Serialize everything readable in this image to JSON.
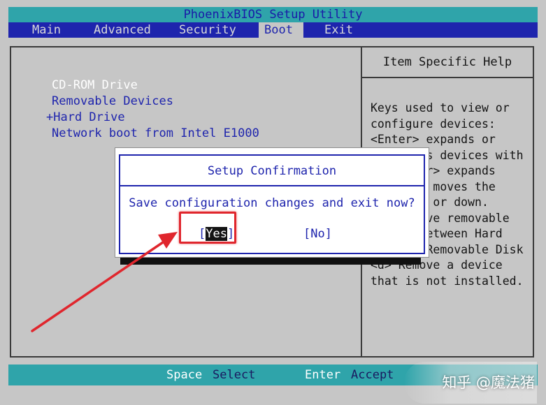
{
  "title": "PhoenixBIOS Setup Utility",
  "menu": [
    {
      "label": "Main"
    },
    {
      "label": "Advanced"
    },
    {
      "label": "Security"
    },
    {
      "label": "Boot"
    },
    {
      "label": "Exit"
    }
  ],
  "active_menu": "Boot",
  "boot_list": [
    "CD-ROM Drive",
    "Removable Devices",
    "+Hard Drive",
    "Network boot from Intel E1000"
  ],
  "selected_boot_item": "CD-ROM Drive",
  "help": {
    "title": "Item Specific Help",
    "lines": [
      "Keys used to view or",
      "configure devices:",
      "<Enter> expands or",
      "        s devices with",
      "",
      "      ter> expands",
      "",
      "     <-> moves the",
      "       p or down.",
      "       ove removable",
      "device between Hard",
      "Disk or Removable Disk",
      "<d> Remove a device",
      "that is not installed."
    ]
  },
  "dialog": {
    "title": "Setup Confirmation",
    "question": "Save configuration changes and exit now?",
    "yes_open": "[",
    "yes_label": "Yes",
    "yes_close": "]",
    "no_label": "[No]"
  },
  "status": [
    {
      "key": "Space",
      "desc": "Select"
    },
    {
      "key": "Enter",
      "desc": "Accept"
    }
  ],
  "watermark": "知乎 @魔法猪",
  "colors": {
    "bios_blue": "#1e24ad",
    "bios_cyan": "#2fa4aa",
    "bios_gray": "#c6c6c6",
    "annotation_red": "#e0262d"
  }
}
